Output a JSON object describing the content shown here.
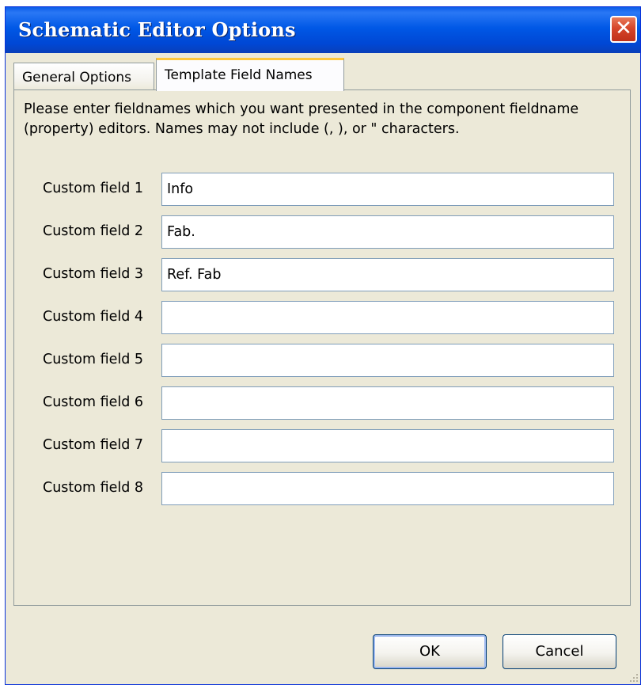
{
  "window": {
    "title": "Schematic Editor Options",
    "close_glyph": "✕"
  },
  "tabs": [
    {
      "label": "General Options",
      "active": false
    },
    {
      "label": "Template Field Names",
      "active": true
    }
  ],
  "panel": {
    "instructions": "Please enter fieldnames which you want presented in the component fieldname (property) editors.  Names may not include (, ), or \" characters."
  },
  "fields": [
    {
      "label": "Custom field 1",
      "value": "Info"
    },
    {
      "label": "Custom field 2",
      "value": "Fab."
    },
    {
      "label": "Custom field 3",
      "value": "Ref. Fab"
    },
    {
      "label": "Custom field 4",
      "value": ""
    },
    {
      "label": "Custom field 5",
      "value": ""
    },
    {
      "label": "Custom field 6",
      "value": ""
    },
    {
      "label": "Custom field 7",
      "value": ""
    },
    {
      "label": "Custom field 8",
      "value": ""
    }
  ],
  "buttons": {
    "ok_label": "OK",
    "cancel_label": "Cancel"
  },
  "colors": {
    "titlebar": "#0058e6",
    "dialog_bg": "#ece9d8",
    "active_tab_accent": "#ffc83c",
    "close_button": "#d6462a"
  },
  "icons": {
    "close": "close-icon",
    "resize": "resize-grip-icon"
  }
}
